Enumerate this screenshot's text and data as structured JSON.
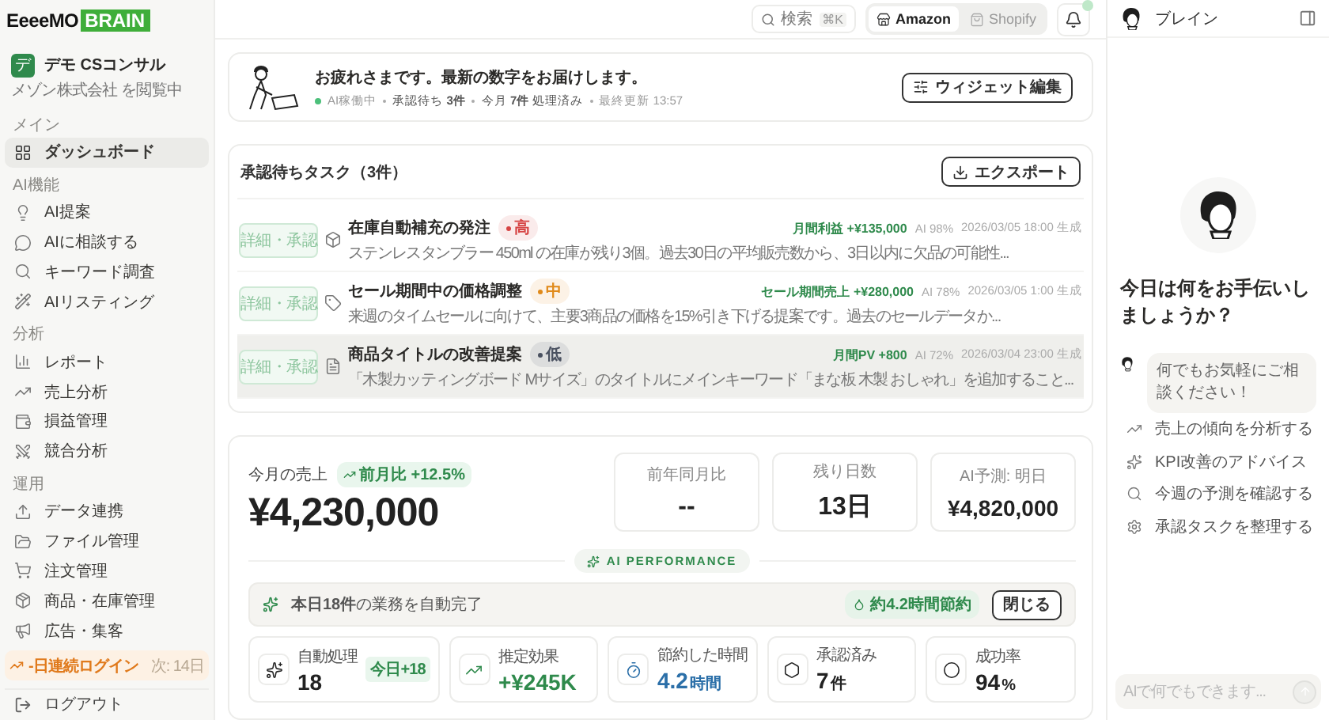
{
  "brand": {
    "name": "EeeeMO",
    "badge": "BRAIN"
  },
  "workspace": {
    "initial": "デ",
    "name": "デモ CSコンサル",
    "subtitle": "メゾン株式会社 を閲覧中"
  },
  "sidebar": {
    "sections": [
      {
        "title": "メイン",
        "items": [
          {
            "label": "ダッシュボード",
            "selected": true
          }
        ]
      },
      {
        "title": "AI機能",
        "items": [
          {
            "label": "AI提案",
            "selected": false
          },
          {
            "label": "AIに相談する",
            "selected": false
          },
          {
            "label": "キーワード調査",
            "selected": false
          },
          {
            "label": "AIリスティング",
            "selected": false
          }
        ]
      },
      {
        "title": "分析",
        "items": [
          {
            "label": "レポート",
            "selected": false
          },
          {
            "label": "売上分析",
            "selected": false
          },
          {
            "label": "損益管理",
            "selected": false
          },
          {
            "label": "競合分析",
            "selected": false
          }
        ]
      },
      {
        "title": "運用",
        "items": [
          {
            "label": "データ連携",
            "selected": false
          },
          {
            "label": "ファイル管理",
            "selected": false
          },
          {
            "label": "注文管理",
            "selected": false
          },
          {
            "label": "商品・在庫管理",
            "selected": false
          },
          {
            "label": "広告・集客",
            "selected": false
          }
        ]
      }
    ]
  },
  "streak": {
    "label": "-日連続ログイン",
    "next": "次: 14日"
  },
  "logout": "ログアウト",
  "header": {
    "search": {
      "label": "検索",
      "shortcut": "⌘K"
    },
    "stores": [
      {
        "label": "Amazon",
        "selected": true
      },
      {
        "label": "Shopify",
        "selected": false
      }
    ],
    "notification": true
  },
  "greeting": {
    "title": "お疲れさまです。最新の数字をお届けします。",
    "status": "AI稼働中",
    "online": true,
    "facts": [
      "承認待ち **3件**",
      "今月 **7件** 処理済み"
    ],
    "updated": "最終更新 13:57",
    "button": "ウィジェット編集"
  },
  "tasks": {
    "title": "承認待ちタスク（3件）",
    "export": "エクスポート",
    "items": [
      {
        "action": "詳細・承認",
        "title": "在庫自動補充の発注",
        "priority": "高",
        "color": "#d64545",
        "description": "ステンレスタンブラー 450ml の在庫が残り3個。過去30日の平均販売数から、3日以内に欠品の可能性...",
        "metric": "月間利益 +¥135,000",
        "ai": "AI 98%",
        "date": "2026/03/05 18:00 生成",
        "highlighted": false
      },
      {
        "action": "詳細・承認",
        "title": "セール期間中の価格調整",
        "priority": "中",
        "color": "#e08a1a",
        "description": "来週のタイムセールに向けて、主要3商品の価格を15%引き下げる提案です。過去のセールデータか...",
        "metric": "セール期間売上 +¥280,000",
        "ai": "AI 78%",
        "date": "2026/03/05 1:00 生成",
        "highlighted": false
      },
      {
        "action": "詳細・承認",
        "title": "商品タイトルの改善提案",
        "priority": "低",
        "color": "#4a5160",
        "description": "「木製カッティングボード Mサイズ」のタイトルにメインキーワード「まな板 木製 おしゃれ」を追加すること...",
        "metric": "月間PV +800",
        "ai": "AI 72%",
        "date": "2026/03/04 23:00 生成",
        "highlighted": true
      }
    ]
  },
  "sales": {
    "label": "今月の売上",
    "change": "前月比 +12.5%",
    "value": "¥4,230,000",
    "kpis": [
      {
        "label": "前年同月比",
        "value": "--"
      },
      {
        "label": "残り日数",
        "value": "13日"
      },
      {
        "label": "AI予測: 明日",
        "value": "¥4,820,000"
      }
    ]
  },
  "ai_performance": {
    "label": "AI PERFORMANCE",
    "banner": "**本日18件**の業務を自動完了",
    "saved": "約4.2時間節約",
    "close": "閉じる",
    "stats": [
      {
        "label": "自動処理",
        "value": "18",
        "badge": "今日+18",
        "color": "#222222"
      },
      {
        "label": "推定効果",
        "value": "+¥245K",
        "color": "#2f8a4c"
      },
      {
        "label": "節約した時間",
        "value": "4.2",
        "unit": "時間",
        "color": "#2b6fa8"
      },
      {
        "label": "承認済み",
        "value": "7",
        "unit": "件",
        "color": "#222222"
      },
      {
        "label": "成功率",
        "value": "94",
        "unit": "%",
        "color": "#222222"
      }
    ]
  },
  "assistant": {
    "title": "ブレイン",
    "greeting": "今日は何をお手伝いしましょうか？",
    "message": "何でもお気軽にご相談ください！",
    "suggestions": [
      "売上の傾向を分析する",
      "KPI改善のアドバイス",
      "今週の予測を確認する",
      "承認タスクを整理する"
    ],
    "placeholder": "AIで何でもできます..."
  }
}
